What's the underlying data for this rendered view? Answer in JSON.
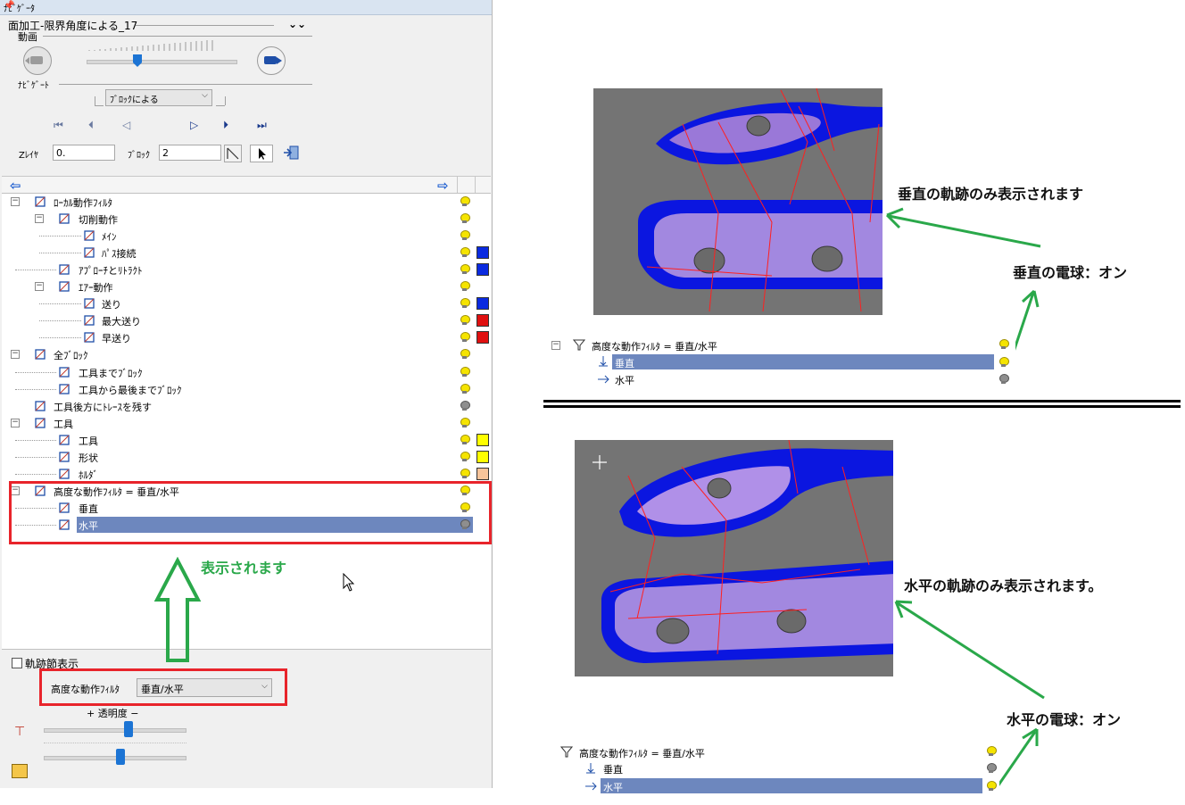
{
  "navigator": {
    "title": "ﾅﾋﾞｹﾞｰﾀ",
    "pin_icon": "pin-icon",
    "program_name": "面加工-限界角度による_17",
    "video_section": "動画",
    "navigate_section": "ﾅﾋﾞｹﾞｰﾄ",
    "mode_select": "ﾌﾞﾛｯｸによる",
    "zlayer_label": "Zﾚｲﾔ",
    "zlayer_value": "0.",
    "block_label": "ﾌﾞﾛｯｸ",
    "block_value": "2"
  },
  "tree": [
    {
      "label": "ﾛｰｶﾙ動作ﾌｨﾙﾀ",
      "level": 0,
      "icon": "filter-icon",
      "expander": "−",
      "bulb": "on",
      "swatch": null
    },
    {
      "label": "切削動作",
      "level": 1,
      "icon": "cut-icon",
      "expander": "−",
      "bulb": "on",
      "swatch": null
    },
    {
      "label": "ﾒｲﾝ",
      "level": 2,
      "icon": "main-icon",
      "expander": null,
      "bulb": "on",
      "swatch": null
    },
    {
      "label": "ﾊﾟｽ接続",
      "level": 2,
      "icon": "link-icon",
      "expander": null,
      "bulb": "on",
      "swatch": "#0a2ae0"
    },
    {
      "label": "ｱﾌﾟﾛｰﾁとﾘﾄﾗｸﾄ",
      "level": 1,
      "icon": "approach-icon",
      "expander": null,
      "bulb": "on",
      "swatch": "#0a2ae0"
    },
    {
      "label": "ｴｱｰ動作",
      "level": 1,
      "icon": "air-icon",
      "expander": "−",
      "bulb": "on",
      "swatch": null
    },
    {
      "label": "送り",
      "level": 2,
      "icon": "feed-icon",
      "expander": null,
      "bulb": "on",
      "swatch": "#0a2ae0"
    },
    {
      "label": "最大送り",
      "level": 2,
      "icon": "maxfeed-icon",
      "expander": null,
      "bulb": "on",
      "swatch": "#e01010"
    },
    {
      "label": "早送り",
      "level": 2,
      "icon": "rapid-icon",
      "expander": null,
      "bulb": "on",
      "swatch": "#e01010"
    },
    {
      "label": "全ﾌﾞﾛｯｸ",
      "level": 0,
      "icon": "allblock-icon",
      "expander": "−",
      "bulb": "on",
      "swatch": null
    },
    {
      "label": "工具までﾌﾞﾛｯｸ",
      "level": 1,
      "icon": "toolblock-icon",
      "expander": null,
      "bulb": "on",
      "swatch": null
    },
    {
      "label": "工具から最後までﾌﾞﾛｯｸ",
      "level": 1,
      "icon": "toolend-icon",
      "expander": null,
      "bulb": "on",
      "swatch": null
    },
    {
      "label": "工具後方にﾄﾚｰｽを残す",
      "level": 0,
      "icon": "trace-icon",
      "expander": null,
      "bulb": "off",
      "swatch": null
    },
    {
      "label": "工具",
      "level": 0,
      "icon": "tool-icon",
      "expander": "−",
      "bulb": "on",
      "swatch": null
    },
    {
      "label": "工具",
      "level": 1,
      "icon": "tool-icon",
      "expander": null,
      "bulb": "on",
      "swatch": "#ffff00"
    },
    {
      "label": "形状",
      "level": 1,
      "icon": "shape-icon",
      "expander": null,
      "bulb": "on",
      "swatch": "#ffff00"
    },
    {
      "label": "ﾎﾙﾀﾞ",
      "level": 1,
      "icon": "holder-icon",
      "expander": null,
      "bulb": "on",
      "swatch": "#f7c49a"
    },
    {
      "label": "高度な動作ﾌｨﾙﾀ = 垂直/水平",
      "level": 0,
      "icon": "advfilter-icon",
      "expander": "−",
      "bulb": "on",
      "swatch": null
    },
    {
      "label": "垂直",
      "level": 1,
      "icon": "vertical-icon",
      "expander": null,
      "bulb": "on",
      "swatch": null
    },
    {
      "label": "水平",
      "level": 1,
      "icon": "horizontal-icon",
      "expander": null,
      "bulb": "off",
      "swatch": null,
      "selected": true
    }
  ],
  "bottom": {
    "trace_checkbox": "軌跡節表示",
    "adv_filter_label": "高度な動作ﾌｨﾙﾀ",
    "adv_filter_value": "垂直/水平",
    "transparency_label": "+ 透明度 −"
  },
  "annotations": {
    "displayed": "表示されます",
    "vertical_only": "垂直の軌跡のみ表示されます",
    "vertical_bulb_on": "垂直の電球：オン",
    "horizontal_only": "水平の軌跡のみ表示されます。",
    "horizontal_bulb_on": "水平の電球：オン"
  },
  "mini_tree_top": {
    "parent": "高度な動作ﾌｨﾙﾀ = 垂直/水平",
    "vertical": "垂直",
    "horizontal": "水平"
  },
  "mini_tree_bottom": {
    "parent": "高度な動作ﾌｨﾙﾀ = 垂直/水平",
    "vertical": "垂直",
    "horizontal": "水平"
  },
  "colors": {
    "selection": "#6d87be",
    "annotation_green": "#2aa84a",
    "highlight_red": "#e8242b",
    "bulb_on": "#f5e400",
    "bulb_off": "#8e8e8e"
  }
}
